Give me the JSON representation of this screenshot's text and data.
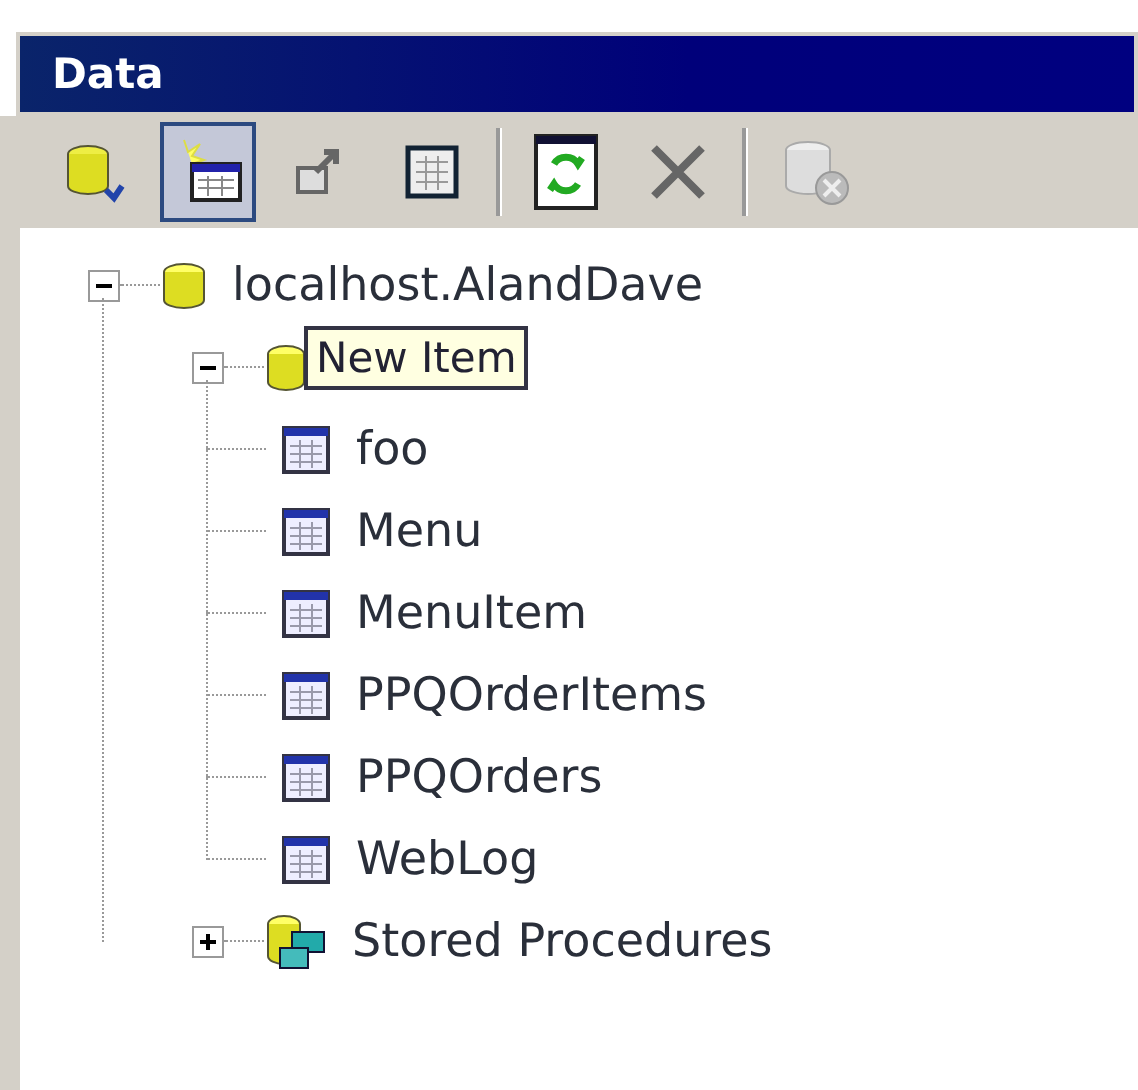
{
  "window": {
    "title": "Data"
  },
  "toolbar": [
    {
      "kind": "add-database",
      "pressed": false
    },
    {
      "kind": "new-table",
      "pressed": true
    },
    {
      "kind": "export",
      "pressed": false
    },
    {
      "kind": "table",
      "pressed": false
    },
    {
      "kind": "separator"
    },
    {
      "kind": "refresh",
      "pressed": false
    },
    {
      "kind": "delete",
      "pressed": false
    },
    {
      "kind": "separator"
    },
    {
      "kind": "disconnect",
      "pressed": false
    }
  ],
  "tree": [
    {
      "kind": "database",
      "label": "localhost.AlandDave",
      "expanded": true,
      "children": [
        {
          "kind": "folder",
          "expanded": true,
          "children": [
            {
              "kind": "table",
              "label": "foo"
            },
            {
              "kind": "table",
              "label": "Menu"
            },
            {
              "kind": "table",
              "label": "MenuItem"
            },
            {
              "kind": "table",
              "label": "PPQOrderItems"
            },
            {
              "kind": "table",
              "label": "PPQOrders"
            },
            {
              "kind": "table",
              "label": "WebLog"
            }
          ]
        },
        {
          "kind": "procedures",
          "label": "Stored Procedures",
          "expanded": false
        }
      ]
    }
  ],
  "tooltip": {
    "text": "New Item"
  }
}
